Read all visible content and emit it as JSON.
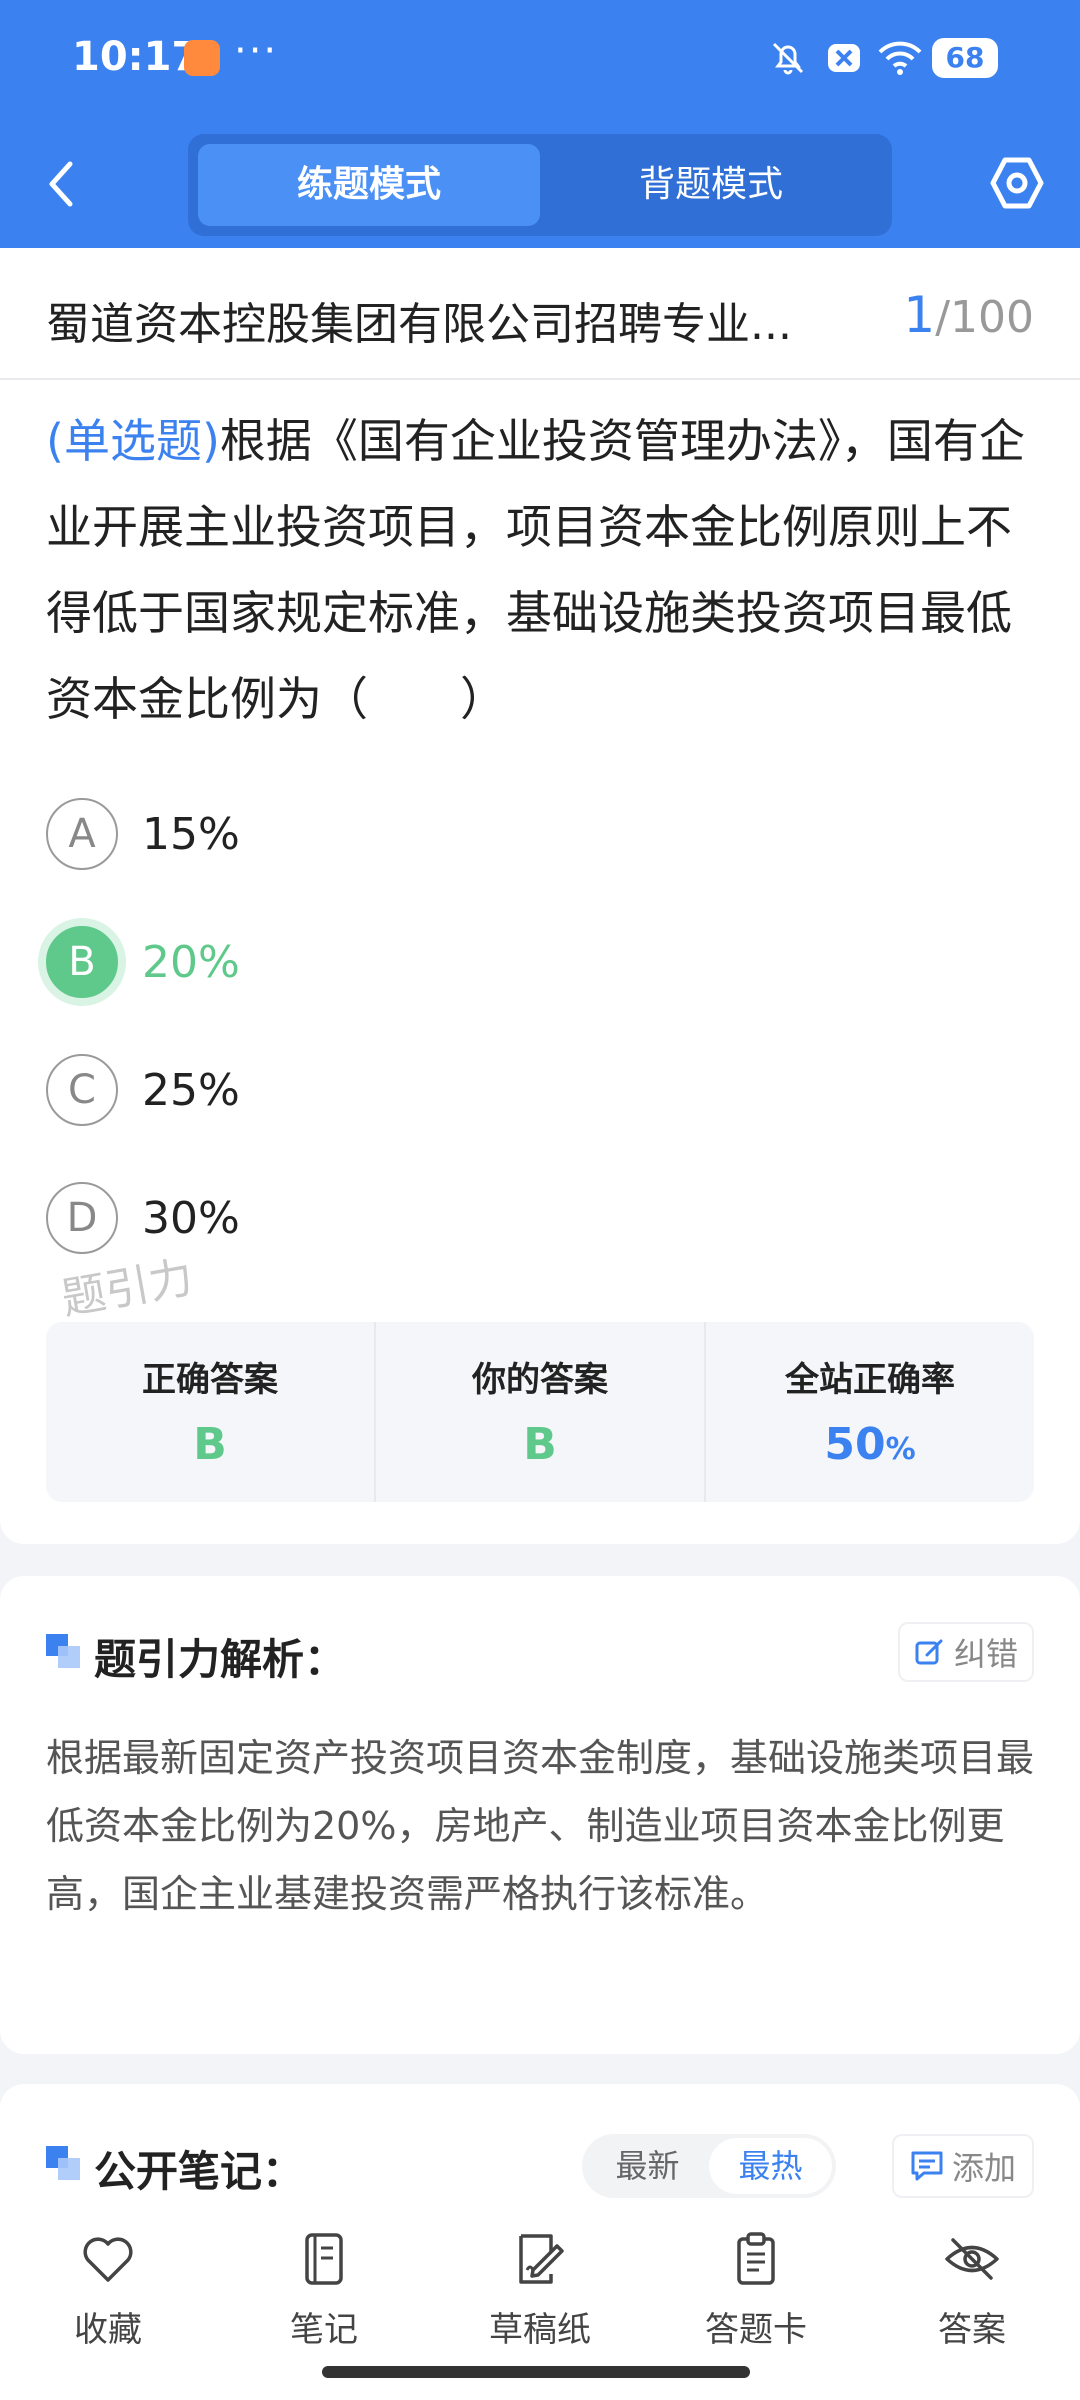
{
  "status_bar": {
    "time": "10:17",
    "more": "···",
    "battery": "68"
  },
  "header": {
    "tabs": [
      {
        "label": "练题模式",
        "active": true
      },
      {
        "label": "背题模式",
        "active": false
      }
    ]
  },
  "exam": {
    "title": "蜀道资本控股集团有限公司招聘专业...",
    "current": "1",
    "total": "/100"
  },
  "question": {
    "type": "(单选题)",
    "text": "根据《国有企业投资管理办法》，国有企业开展主业投资项目，项目资本金比例原则上不得低于国家规定标准，基础设施类投资项目最低资本金比例为（　　）"
  },
  "options": [
    {
      "letter": "A",
      "text": "15%"
    },
    {
      "letter": "B",
      "text": "20%",
      "correct": true
    },
    {
      "letter": "C",
      "text": "25%"
    },
    {
      "letter": "D",
      "text": "30%"
    }
  ],
  "watermark": "题引力",
  "answer_summary": {
    "correct_label": "正确答案",
    "correct_value": "B",
    "yours_label": "你的答案",
    "yours_value": "B",
    "rate_label": "全站正确率",
    "rate_value": "50",
    "rate_unit": "%"
  },
  "analysis": {
    "title": "题引力解析：",
    "report_label": "纠错",
    "text": "根据最新固定资产投资项目资本金制度，基础设施类项目最低资本金比例为20%，房地产、制造业项目资本金比例更高，国企主业基建投资需严格执行该标准。"
  },
  "notes": {
    "title": "公开笔记：",
    "sort_options": [
      "最新",
      "最热"
    ],
    "add_label": "添加"
  },
  "bottom_tabs": [
    {
      "label": "收藏",
      "icon": "heart-icon"
    },
    {
      "label": "笔记",
      "icon": "notebook-icon"
    },
    {
      "label": "草稿纸",
      "icon": "draft-paper-icon"
    },
    {
      "label": "答题卡",
      "icon": "answer-sheet-icon"
    },
    {
      "label": "答案",
      "icon": "eye-off-icon"
    }
  ],
  "colors": {
    "primary": "#3b82f0",
    "correct": "#5ec98a",
    "header_dark": "#2f6fd6"
  }
}
